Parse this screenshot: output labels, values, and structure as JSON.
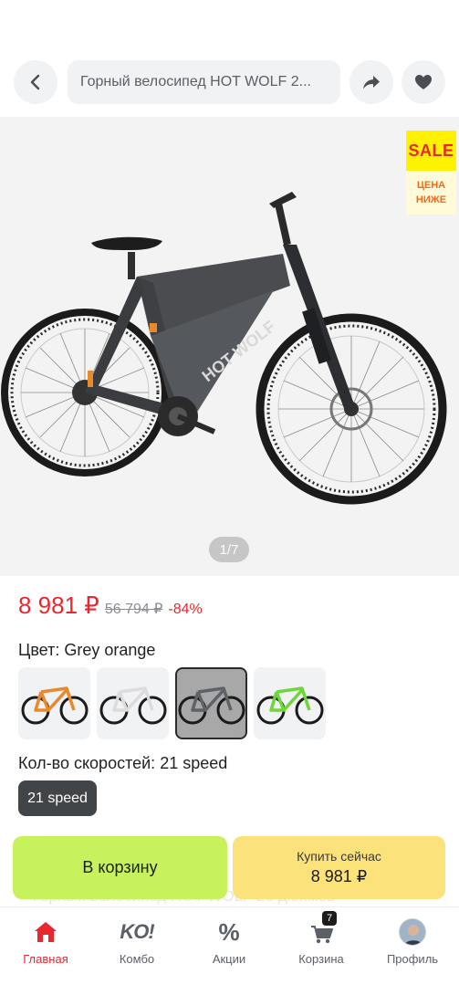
{
  "header": {
    "title": "Горный велосипед HOT WOLF 2...",
    "back_icon": "chevron-left-icon",
    "share_icon": "share-arrow-icon",
    "favorite_icon": "heart-icon"
  },
  "gallery": {
    "sale_badge_top": "SALE",
    "sale_badge_line1": "ЦЕНА",
    "sale_badge_line2": "НИЖЕ",
    "counter": "1/7",
    "bike_brand_text": "HOT WOLF"
  },
  "price": {
    "current": "8 981 ₽",
    "old": "56 794 ₽",
    "discount": "-84%"
  },
  "color": {
    "label": "Цвет: Grey orange",
    "options": [
      {
        "name": "orange",
        "accent": "#e8892c",
        "selected": false
      },
      {
        "name": "white",
        "accent": "#dcdcdc",
        "selected": false
      },
      {
        "name": "grey",
        "accent": "#5e6166",
        "selected": true
      },
      {
        "name": "green",
        "accent": "#6fd63a",
        "selected": false
      }
    ]
  },
  "speeds": {
    "label": "Кол-во скоростей: 21 speed",
    "selected": "21 speed"
  },
  "actions": {
    "add_to_cart": "В корзину",
    "buy_now_label": "Купить сейчас",
    "buy_now_price": "8 981 ₽",
    "behind_text": "Горный велосипед HOT WOLF 26 дюймов"
  },
  "nav": {
    "items": [
      {
        "label": "Главная",
        "icon": "home-icon",
        "active": true
      },
      {
        "label": "Комбо",
        "icon": "ko-logo-icon",
        "active": false
      },
      {
        "label": "Акции",
        "icon": "percent-icon",
        "active": false
      },
      {
        "label": "Корзина",
        "icon": "cart-icon",
        "active": false
      },
      {
        "label": "Профиль",
        "icon": "avatar",
        "active": false
      }
    ],
    "cart_count": "7",
    "combo_logo": "KO!",
    "percent_glyph": "%"
  },
  "colors": {
    "price_red": "#e8282f",
    "cart_green": "#c8f25c",
    "buy_yellow": "#fbe27a",
    "chip_dark": "#424548"
  }
}
